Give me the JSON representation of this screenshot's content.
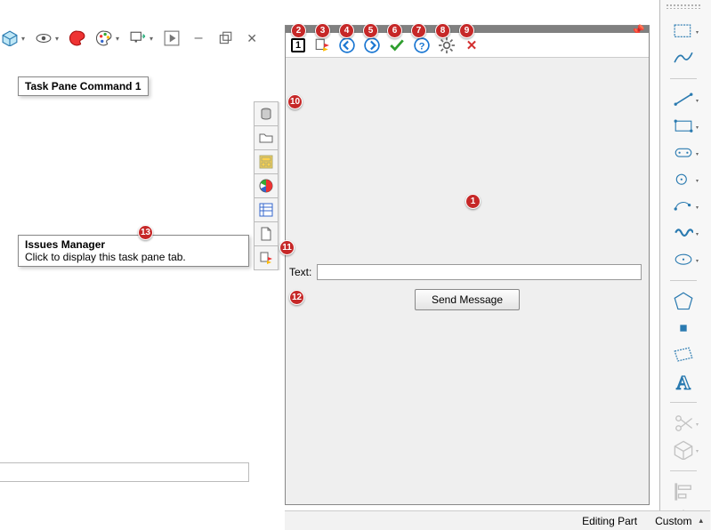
{
  "tooltips": {
    "taskpane_command": "Task Pane Command 1",
    "issues_title": "Issues Manager",
    "issues_body": "Click to display this task pane tab."
  },
  "taskpane": {
    "text_label": "Text:",
    "text_value": "",
    "send_label": "Send Message"
  },
  "status": {
    "editing": "Editing Part",
    "custom": "Custom"
  },
  "badges": {
    "b1": "1",
    "b2": "2",
    "b3": "3",
    "b4": "4",
    "b5": "5",
    "b6": "6",
    "b7": "7",
    "b8": "8",
    "b9": "9",
    "b10": "10",
    "b11": "11",
    "b12": "12",
    "b13": "13"
  },
  "top_toolbar": {
    "items": [
      "cube",
      "dd",
      "eye",
      "dd",
      "palette-red",
      "palette-multi",
      "dd",
      "monitor",
      "dd",
      "play",
      "minimize",
      "restore",
      "close"
    ]
  }
}
